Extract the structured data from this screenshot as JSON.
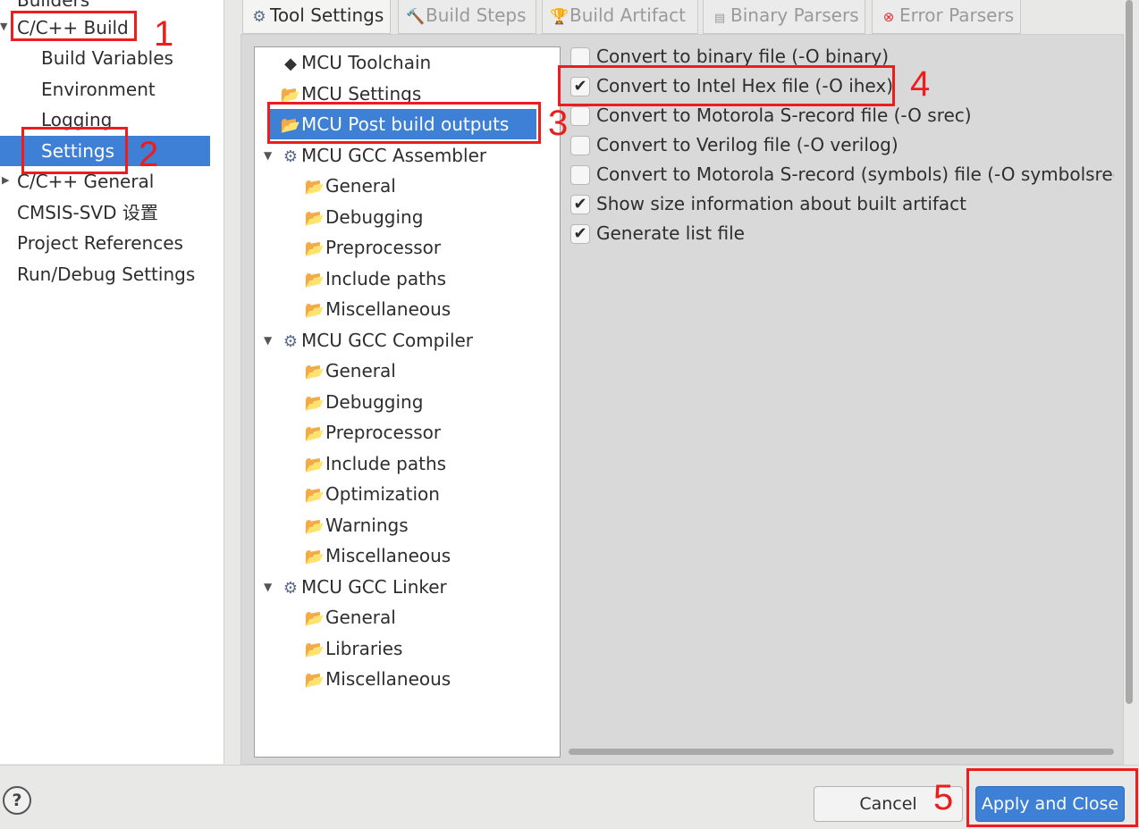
{
  "colors": {
    "selection": "#3d80d6",
    "annotation": "#ee1c1c"
  },
  "nav": {
    "items": [
      {
        "label": "Builders"
      },
      {
        "label": "C/C++ Build",
        "expanded": true
      },
      {
        "label": "Build Variables"
      },
      {
        "label": "Environment"
      },
      {
        "label": "Logging"
      },
      {
        "label": "Settings",
        "selected": true
      },
      {
        "label": "C/C++ General",
        "expanded": false
      },
      {
        "label": "CMSIS-SVD 设置"
      },
      {
        "label": "Project References"
      },
      {
        "label": "Run/Debug Settings"
      }
    ]
  },
  "tabs": [
    {
      "label": "Tool Settings",
      "icon": "gear-icon",
      "active": true
    },
    {
      "label": "Build Steps",
      "icon": "hammer-icon"
    },
    {
      "label": "Build Artifact",
      "icon": "trophy-icon"
    },
    {
      "label": "Binary Parsers",
      "icon": "binary-file-icon"
    },
    {
      "label": "Error Parsers",
      "icon": "error-icon"
    }
  ],
  "tree": {
    "items": [
      {
        "label": "MCU Toolchain",
        "icon": "chip-icon"
      },
      {
        "label": "MCU Settings",
        "icon": "settings-folder-icon"
      },
      {
        "label": "MCU Post build outputs",
        "icon": "settings-folder-icon",
        "selected": true
      },
      {
        "label": "MCU GCC Assembler",
        "icon": "gear-icon",
        "expanded": true
      },
      {
        "label": "General",
        "icon": "settings-folder-icon"
      },
      {
        "label": "Debugging",
        "icon": "settings-folder-icon"
      },
      {
        "label": "Preprocessor",
        "icon": "settings-folder-icon"
      },
      {
        "label": "Include paths",
        "icon": "settings-folder-icon"
      },
      {
        "label": "Miscellaneous",
        "icon": "settings-folder-icon"
      },
      {
        "label": "MCU GCC Compiler",
        "icon": "gear-icon",
        "expanded": true
      },
      {
        "label": "General",
        "icon": "settings-folder-icon"
      },
      {
        "label": "Debugging",
        "icon": "settings-folder-icon"
      },
      {
        "label": "Preprocessor",
        "icon": "settings-folder-icon"
      },
      {
        "label": "Include paths",
        "icon": "settings-folder-icon"
      },
      {
        "label": "Optimization",
        "icon": "settings-folder-icon"
      },
      {
        "label": "Warnings",
        "icon": "settings-folder-icon"
      },
      {
        "label": "Miscellaneous",
        "icon": "settings-folder-icon"
      },
      {
        "label": "MCU GCC Linker",
        "icon": "gear-icon",
        "expanded": true
      },
      {
        "label": "General",
        "icon": "settings-folder-icon"
      },
      {
        "label": "Libraries",
        "icon": "settings-folder-icon"
      },
      {
        "label": "Miscellaneous",
        "icon": "settings-folder-icon"
      }
    ]
  },
  "options": [
    {
      "label": "Convert to binary file (-O binary)",
      "checked": false
    },
    {
      "label": "Convert to Intel Hex file (-O ihex)",
      "checked": true
    },
    {
      "label": "Convert to Motorola S-record file (-O srec)",
      "checked": false
    },
    {
      "label": "Convert to Verilog file (-O verilog)",
      "checked": false
    },
    {
      "label": "Convert to Motorola S-record (symbols) file (-O symbolsrec)",
      "checked": false
    },
    {
      "label": "Show size information about built artifact",
      "checked": true
    },
    {
      "label": "Generate list file",
      "checked": true
    }
  ],
  "buttons": {
    "help": "?",
    "cancel": "Cancel",
    "apply": "Apply and Close"
  },
  "annotations": [
    "1",
    "2",
    "3",
    "4",
    "5"
  ]
}
